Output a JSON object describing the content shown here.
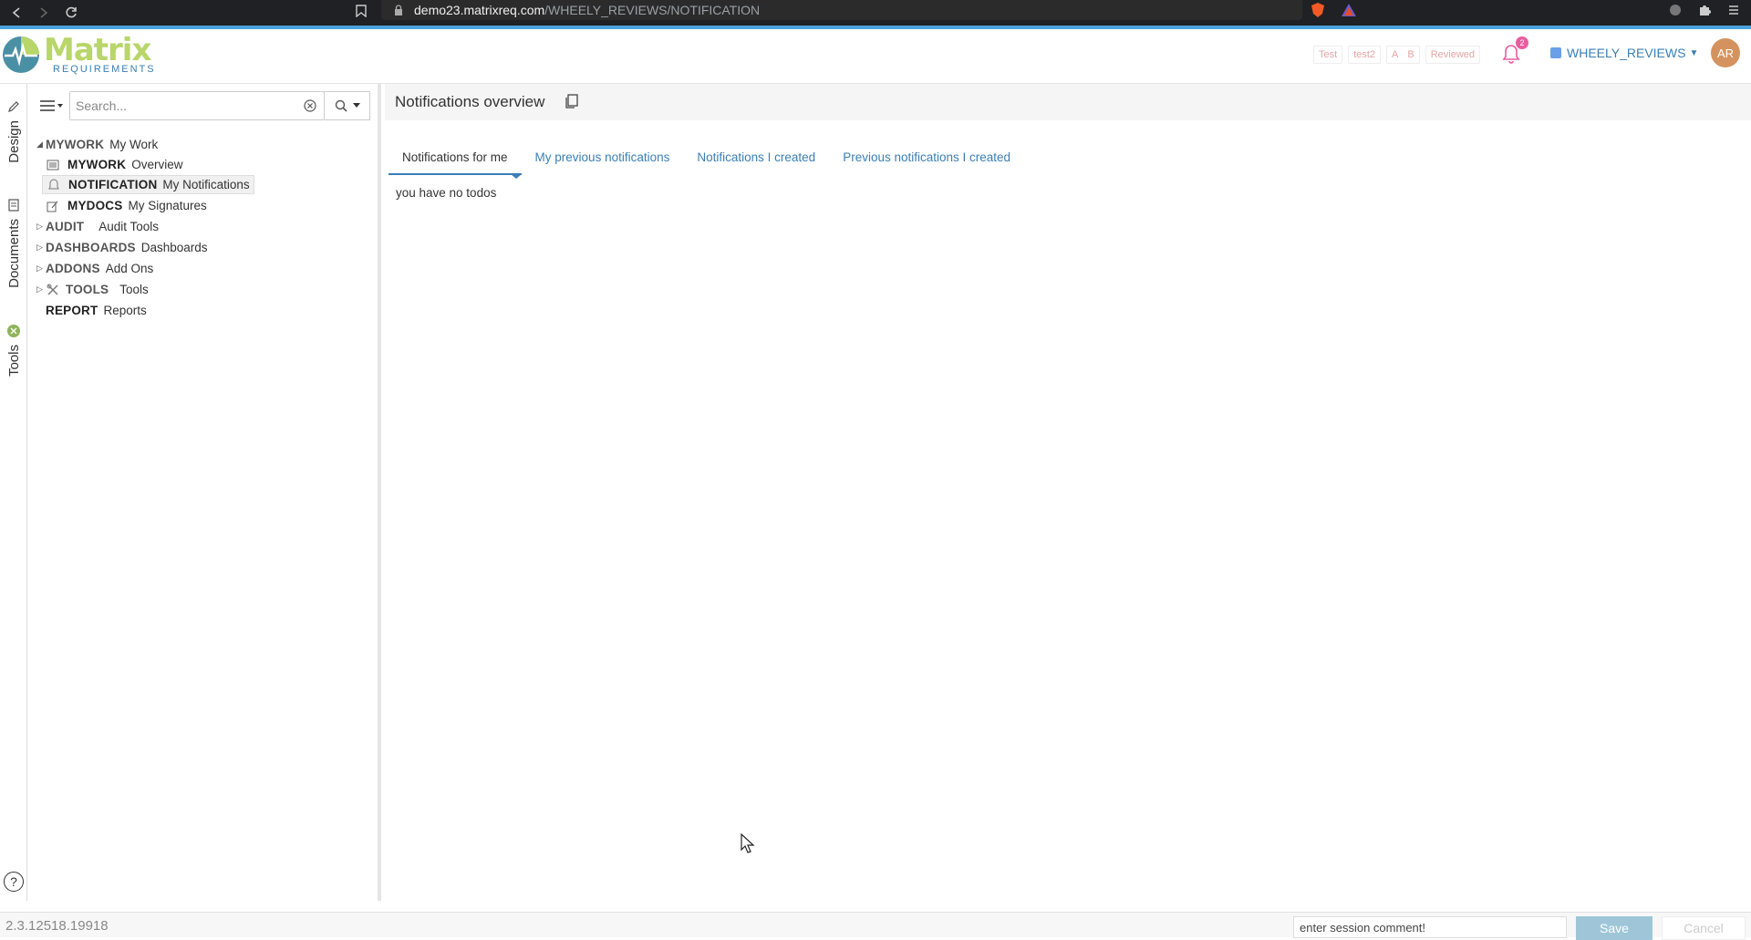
{
  "browser": {
    "url_host": "demo23.matrixreq.com",
    "url_path": "/WHEELY_REVIEWS/NOTIFICATION",
    "icons": [
      "back-icon",
      "forward-icon",
      "reload-icon",
      "bookmark-icon",
      "lock-icon",
      "brave-shield-icon",
      "brave-rewards-icon",
      "extensions-icon",
      "puzzle-icon",
      "menu-icon"
    ]
  },
  "header": {
    "logo_word": "Matrix",
    "logo_sub": "REQUIREMENTS",
    "tags": [
      "Test",
      "test2"
    ],
    "tag_group": [
      "A",
      "B"
    ],
    "reviewed_tag": "Reviewed",
    "notification_count": "2",
    "project": "WHEELY_REVIEWS",
    "avatar": "AR",
    "colors": {
      "brand_green": "#b8d66a",
      "brand_blue": "#3a7fb5",
      "badge": "#e85da0",
      "avatar": "#d4935e"
    }
  },
  "vtabs": {
    "design": "Design",
    "documents": "Documents",
    "tools": "Tools",
    "help": "?"
  },
  "tree": {
    "search_placeholder": "Search...",
    "items": [
      {
        "key": "MYWORK",
        "title": "My Work"
      },
      {
        "key": "MYWORK",
        "title": "Overview"
      },
      {
        "key": "NOTIFICATION",
        "title": "My Notifications"
      },
      {
        "key": "MYDOCS",
        "title": "My Signatures"
      },
      {
        "key": "AUDIT",
        "title": "Audit Tools"
      },
      {
        "key": "DASHBOARDS",
        "title": "Dashboards"
      },
      {
        "key": "ADDONS",
        "title": "Add Ons"
      },
      {
        "key": "TOOLS",
        "title": "Tools"
      },
      {
        "key": "REPORT",
        "title": "Reports"
      }
    ]
  },
  "main": {
    "title": "Notifications overview",
    "tabs": [
      "Notifications for me",
      "My previous notifications",
      "Notifications I created",
      "Previous notifications I created"
    ],
    "empty_text": "you have no todos"
  },
  "footer": {
    "version": "2.3.12518.19918",
    "session_placeholder": "enter session comment!",
    "save_label": "Save",
    "cancel_label": "Cancel"
  }
}
